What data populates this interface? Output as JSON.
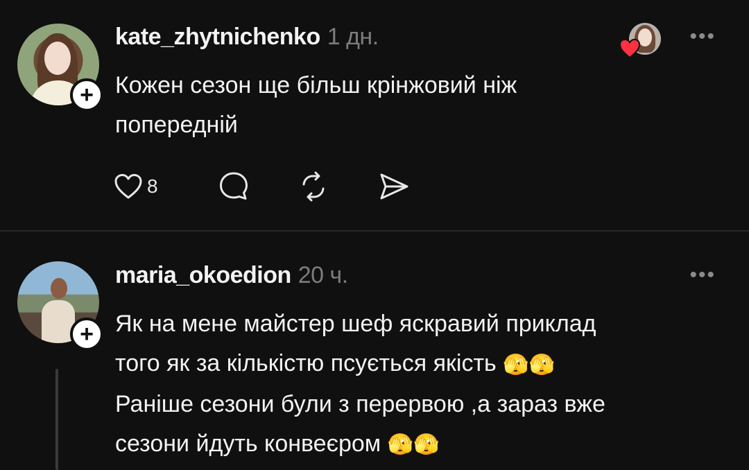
{
  "posts": [
    {
      "username": "kate_zhytnichenko",
      "time": "1 дн.",
      "text_lines": [
        "Кожен сезон ще більш крінжовий ніж",
        "попередній"
      ],
      "likes": "8",
      "follow_symbol": "+",
      "more_symbol": "•••"
    },
    {
      "username": "maria_okoedion",
      "time": "20 ч.",
      "text_lines": [
        "Як на мене майстер шеф яскравий приклад",
        "того як за кількістю псується якість",
        "Раніше сезони були з перервою ,а зараз вже",
        "сезони йдуть конвеєром"
      ],
      "emoji": "🫣🫣",
      "follow_symbol": "+",
      "more_symbol": "•••"
    }
  ],
  "colors": {
    "background": "#101010",
    "text": "#f3f3f3",
    "muted": "#7c7c7c",
    "heart": "#ff3040"
  }
}
